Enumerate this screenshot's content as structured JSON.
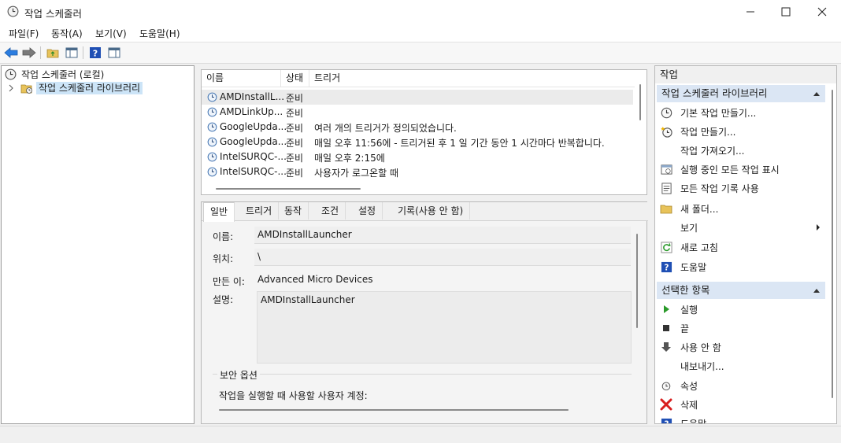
{
  "window": {
    "title": "작업 스케줄러"
  },
  "menu": [
    "파일(F)",
    "동작(A)",
    "보기(V)",
    "도움말(H)"
  ],
  "tree": {
    "root": "작업 스케줄러 (로컬)",
    "child": "작업 스케줄러 라이브러리"
  },
  "task_list": {
    "headers": {
      "name": "이름",
      "status": "상태",
      "trigger": "트리거"
    },
    "rows": [
      {
        "name": "AMDInstallL...",
        "status": "준비",
        "trigger": ""
      },
      {
        "name": "AMDLinkUp...",
        "status": "준비",
        "trigger": ""
      },
      {
        "name": "GoogleUpda...",
        "status": "준비",
        "trigger": "여러 개의 트리거가 정의되었습니다."
      },
      {
        "name": "GoogleUpda...",
        "status": "준비",
        "trigger": "매일 오후 11:56에 - 트리거된 후 1 일 기간 동안 1 시간마다 반복합니다."
      },
      {
        "name": "IntelSURQC-...",
        "status": "준비",
        "trigger": "매일 오후 2:15에"
      },
      {
        "name": "IntelSURQC-...",
        "status": "준비",
        "trigger": "사용자가 로그온할 때"
      }
    ]
  },
  "details": {
    "tabs": [
      "일반",
      "트리거",
      "동작",
      "조건",
      "설정",
      "기록(사용 안 함)"
    ],
    "name_label": "이름:",
    "name_value": "AMDInstallLauncher",
    "location_label": "위치:",
    "location_value": "\\",
    "author_label": "만든 이:",
    "author_value": "Advanced Micro Devices",
    "description_label": "설명:",
    "description_value": "AMDInstallLauncher",
    "security_title": "보안 옵션",
    "security_text": "작업을 실행할 때 사용할 사용자 계정:"
  },
  "actions": {
    "pane_title": "작업",
    "section1": "작업 스케줄러 라이브러리",
    "items1": [
      {
        "label": "기본 작업 만들기...",
        "icon": "basic-task-icon"
      },
      {
        "label": "작업 만들기...",
        "icon": "create-task-icon"
      },
      {
        "label": "작업 가져오기...",
        "icon": ""
      },
      {
        "label": "실행 중인 모든 작업 표시",
        "icon": "running-tasks-icon"
      },
      {
        "label": "모든 작업 기록 사용",
        "icon": "history-icon"
      },
      {
        "label": "새 폴더...",
        "icon": "folder-icon"
      },
      {
        "label": "보기",
        "icon": ""
      },
      {
        "label": "새로 고침",
        "icon": "refresh-icon"
      },
      {
        "label": "도움말",
        "icon": "help-icon"
      }
    ],
    "section2": "선택한 항목",
    "items2": [
      {
        "label": "실행",
        "icon": "run-icon"
      },
      {
        "label": "끝",
        "icon": "stop-icon"
      },
      {
        "label": "사용 안 함",
        "icon": "disable-icon"
      },
      {
        "label": "내보내기...",
        "icon": ""
      },
      {
        "label": "속성",
        "icon": "properties-icon"
      },
      {
        "label": "삭제",
        "icon": "delete-icon"
      },
      {
        "label": "도움말",
        "icon": "help-icon"
      }
    ]
  },
  "colors": {
    "accent": "#dbe6f4",
    "selected_tree": "#cce4f7",
    "delete_red": "#d81e1e"
  }
}
